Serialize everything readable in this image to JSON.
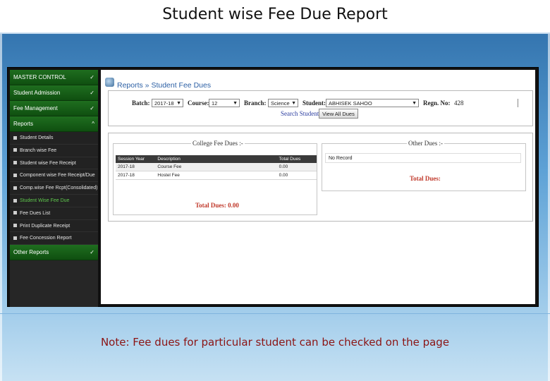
{
  "slide": {
    "title": "Student wise Fee Due Report",
    "note": "Note: Fee dues for particular student can be checked on the page"
  },
  "sidebar": {
    "sections": [
      {
        "label": "MASTER CONTROL",
        "chevron": "✓"
      },
      {
        "label": "Student Admission",
        "chevron": "✓"
      },
      {
        "label": "Fee Management",
        "chevron": "✓"
      },
      {
        "label": "Reports",
        "chevron": "^"
      }
    ],
    "report_items": [
      "Student Details",
      "Branch wise Fee",
      "Student wise Fee Receipt",
      "Component wise Fee Receipt/Due",
      "Comp.wise Fee Rcpt(Consolidated)",
      "Student Wise Fee Due",
      "Fee Dues List",
      "Print Duplicate Receipt",
      "Fee Concession Report"
    ],
    "other_reports": {
      "label": "Other Reports",
      "chevron": "✓"
    }
  },
  "breadcrumb": "Reports » Student Fee Dues",
  "filters": {
    "batch_label": "Batch:",
    "batch_value": "2017-18",
    "course_label": "Course:",
    "course_value": "12",
    "branch_label": "Branch:",
    "branch_value": "Science",
    "student_label": "Student:",
    "student_value": "ABHISEK SAHOO",
    "regn_label": "Regn. No:",
    "regn_value": "428",
    "search_label": "Search Student",
    "view_all_button": "View All Dues"
  },
  "college_fee": {
    "legend": "College Fee Dues :-",
    "headers": [
      "Session Year",
      "Description",
      "Total Dues"
    ],
    "rows": [
      [
        "2017-18",
        "Course Fee",
        "0.00"
      ],
      [
        "2017-18",
        "Hostel Fee",
        "0.00"
      ]
    ],
    "total": "Total Dues: 0.00"
  },
  "other_dues": {
    "legend": "Other Dues :-",
    "no_record": "No Record",
    "total": "Total Dues:"
  },
  "colors": {
    "menu_green": "#1f6e1f",
    "active_item": "#5fc84d",
    "total_red": "#c0392b",
    "link_blue": "#2b5fa4",
    "note_red": "#8b1414"
  }
}
